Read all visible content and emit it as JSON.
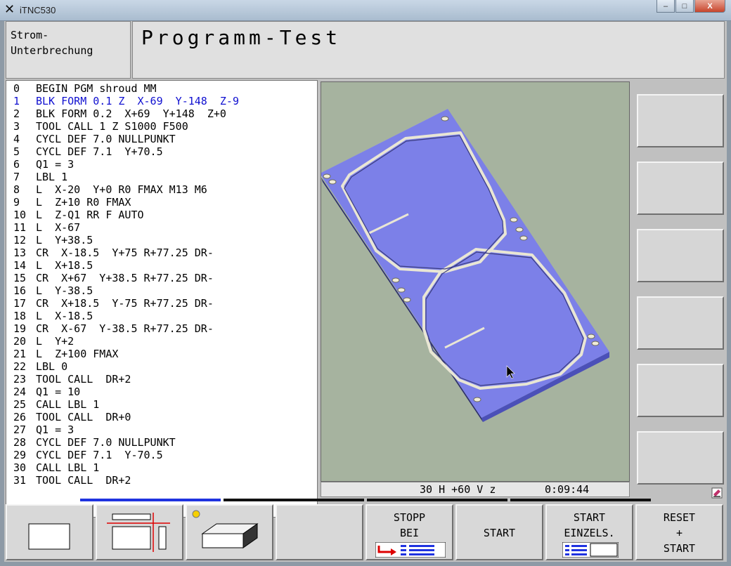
{
  "window": {
    "title": "iTNC530",
    "app_icon": "x-logo-icon",
    "minimize": "–",
    "maximize": "□",
    "close": "X"
  },
  "mode": {
    "line1": "Strom-",
    "line2": "Unterbrechung"
  },
  "header": {
    "title": "Programm-Test"
  },
  "program": [
    {
      "num": "0",
      "text": "BEGIN PGM shroud MM"
    },
    {
      "num": "1",
      "text": "BLK FORM 0.1 Z  X-69  Y-148  Z-9"
    },
    {
      "num": "2",
      "text": "BLK FORM 0.2  X+69  Y+148  Z+0"
    },
    {
      "num": "3",
      "text": "TOOL CALL 1 Z S1000 F500"
    },
    {
      "num": "4",
      "text": "CYCL DEF 7.0 NULLPUNKT"
    },
    {
      "num": "5",
      "text": "CYCL DEF 7.1  Y+70.5"
    },
    {
      "num": "6",
      "text": "Q1 = 3"
    },
    {
      "num": "7",
      "text": "LBL 1"
    },
    {
      "num": "8",
      "text": "L  X-20  Y+0 R0 FMAX M13 M6"
    },
    {
      "num": "9",
      "text": "L  Z+10 R0 FMAX"
    },
    {
      "num": "10",
      "text": "L  Z-Q1 RR F AUTO"
    },
    {
      "num": "11",
      "text": "L  X-67"
    },
    {
      "num": "12",
      "text": "L  Y+38.5"
    },
    {
      "num": "13",
      "text": "CR  X-18.5  Y+75 R+77.25 DR-"
    },
    {
      "num": "14",
      "text": "L  X+18.5"
    },
    {
      "num": "15",
      "text": "CR  X+67  Y+38.5 R+77.25 DR-"
    },
    {
      "num": "16",
      "text": "L  Y-38.5"
    },
    {
      "num": "17",
      "text": "CR  X+18.5  Y-75 R+77.25 DR-"
    },
    {
      "num": "18",
      "text": "L  X-18.5"
    },
    {
      "num": "19",
      "text": "CR  X-67  Y-38.5 R+77.25 DR-"
    },
    {
      "num": "20",
      "text": "L  Y+2"
    },
    {
      "num": "21",
      "text": "L  Z+100 FMAX"
    },
    {
      "num": "22",
      "text": "LBL 0"
    },
    {
      "num": "23",
      "text": "TOOL CALL  DR+2"
    },
    {
      "num": "24",
      "text": "Q1 = 10"
    },
    {
      "num": "25",
      "text": "CALL LBL 1"
    },
    {
      "num": "26",
      "text": "TOOL CALL  DR+0"
    },
    {
      "num": "27",
      "text": "Q1 = 3"
    },
    {
      "num": "28",
      "text": "CYCL DEF 7.0 NULLPUNKT"
    },
    {
      "num": "29",
      "text": "CYCL DEF 7.1  Y-70.5"
    },
    {
      "num": "30",
      "text": "CALL LBL 1"
    },
    {
      "num": "31",
      "text": "TOOL CALL  DR+2"
    }
  ],
  "active_line": 1,
  "view_status": {
    "rotation": "30 H +60 V z",
    "time": "0:09:44"
  },
  "softkeys": {
    "stopp_line1": "STOPP",
    "stopp_line2": "BEI",
    "start": "START",
    "start_single_line1": "START",
    "start_single_line2": "EINZELS.",
    "reset_line1": "RESET",
    "reset_line2": "+",
    "reset_line3": "START"
  },
  "colors": {
    "active_code": "#1010d0",
    "active_tab": "#1f33e0",
    "workpiece": "#7c80e8",
    "graph_bg": "#a6b39f"
  }
}
